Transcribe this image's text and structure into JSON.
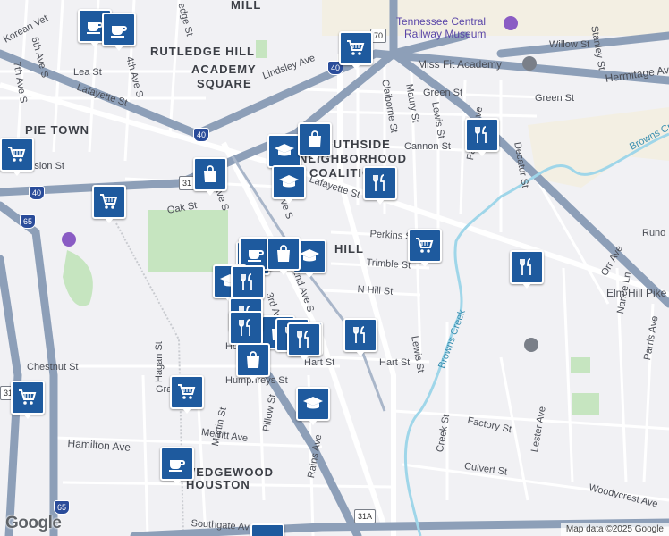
{
  "map": {
    "neighborhoods": [
      {
        "key": "rutledge_hill",
        "text": "RUTLEDGE HILL"
      },
      {
        "key": "academy_square_1",
        "text": "ACADEMY"
      },
      {
        "key": "academy_square_2",
        "text": "SQUARE"
      },
      {
        "key": "pie_town",
        "text": "PIE TOWN"
      },
      {
        "key": "southside_1",
        "text": "SOUTHSIDE"
      },
      {
        "key": "southside_2",
        "text": "NEIGHBORHOOD"
      },
      {
        "key": "southside_3",
        "text": "COALITION"
      },
      {
        "key": "hill",
        "text": "HILL"
      },
      {
        "key": "wedgewood_1",
        "text": "WEDGEWOOD"
      },
      {
        "key": "wedgewood_2",
        "text": "HOUSTON"
      },
      {
        "key": "mill",
        "text": "MILL"
      }
    ],
    "pois": [
      {
        "key": "museum_1",
        "text": "Tennessee Central"
      },
      {
        "key": "museum_2",
        "text": "Railway Museum"
      },
      {
        "key": "missfit",
        "text": "Miss Fit Academy"
      }
    ],
    "streets": [
      {
        "key": "korean_vet",
        "text": "Korean Vet"
      },
      {
        "key": "6th_ave",
        "text": "6th Ave S"
      },
      {
        "key": "4th_ave",
        "text": "4th Ave S"
      },
      {
        "key": "7th_ave",
        "text": "7th Ave S"
      },
      {
        "key": "lea_st",
        "text": "Lea St"
      },
      {
        "key": "lafayette_w",
        "text": "Lafayette St"
      },
      {
        "key": "lafayette_e",
        "text": "Lafayette St"
      },
      {
        "key": "lindsley",
        "text": "Lindsley Ave"
      },
      {
        "key": "claiborne",
        "text": "Claiborne St"
      },
      {
        "key": "maury",
        "text": "Maury St"
      },
      {
        "key": "lewis_n",
        "text": "Lewis St"
      },
      {
        "key": "lewis_s",
        "text": "Lewis St"
      },
      {
        "key": "green_w",
        "text": "Green St"
      },
      {
        "key": "green_e",
        "text": "Green St"
      },
      {
        "key": "fairfield",
        "text": "Fairfield Ave"
      },
      {
        "key": "cannon",
        "text": "Cannon St"
      },
      {
        "key": "decatur",
        "text": "Decatur St"
      },
      {
        "key": "willow",
        "text": "Willow St"
      },
      {
        "key": "stanley",
        "text": "Stanley St"
      },
      {
        "key": "hermitage",
        "text": "Hermitage Ave"
      },
      {
        "key": "browns_creek_n",
        "text": "Browns Creek"
      },
      {
        "key": "browns_creek_s",
        "text": "Browns Creek"
      },
      {
        "key": "division",
        "text": "Division St"
      },
      {
        "key": "oak",
        "text": "Oak St"
      },
      {
        "key": "perkins",
        "text": "Perkins St"
      },
      {
        "key": "trimble",
        "text": "Trimble St"
      },
      {
        "key": "n_hill",
        "text": "N Hill St"
      },
      {
        "key": "runo",
        "text": "Runo"
      },
      {
        "key": "orr",
        "text": "Orr Ave"
      },
      {
        "key": "elm_hill",
        "text": "Elm Hill Pike"
      },
      {
        "key": "nance",
        "text": "Nance Ln"
      },
      {
        "key": "parris",
        "text": "Parris Ave"
      },
      {
        "key": "hart_w",
        "text": "Hart St"
      },
      {
        "key": "hart_e",
        "text": "Hart St"
      },
      {
        "key": "chestnut",
        "text": "Chestnut St"
      },
      {
        "key": "hagan",
        "text": "Hagan St"
      },
      {
        "key": "gra",
        "text": "Gra"
      },
      {
        "key": "martin",
        "text": "Martin St"
      },
      {
        "key": "pillow",
        "text": "Pillow St"
      },
      {
        "key": "humphreys",
        "text": "Humphreys St"
      },
      {
        "key": "merritt",
        "text": "Merritt Ave"
      },
      {
        "key": "hamilton",
        "text": "Hamilton Ave"
      },
      {
        "key": "rains",
        "text": "Rains Ave"
      },
      {
        "key": "creek_st",
        "text": "Creek St"
      },
      {
        "key": "factory",
        "text": "Factory St"
      },
      {
        "key": "lester",
        "text": "Lester Ave"
      },
      {
        "key": "culvert",
        "text": "Culvert St"
      },
      {
        "key": "woodycrest",
        "text": "Woodycrest Ave"
      },
      {
        "key": "southgate",
        "text": "Southgate Ave"
      },
      {
        "key": "3rd_ave",
        "text": "3rd Ave S"
      },
      {
        "key": "2nd_ave",
        "text": "2nd Ave S"
      },
      {
        "key": "ave_s_1",
        "text": "Ave S"
      },
      {
        "key": "ave_s_2",
        "text": "ve S"
      },
      {
        "key": "ho",
        "text": "Ho"
      },
      {
        "key": "edge_st",
        "text": "edge St"
      }
    ],
    "shields": [
      {
        "key": "i40_a",
        "text": "40"
      },
      {
        "key": "i40_b",
        "text": "40"
      },
      {
        "key": "i40_c",
        "text": "40"
      },
      {
        "key": "i65_a",
        "text": "65"
      },
      {
        "key": "i65_b",
        "text": "65"
      },
      {
        "key": "i65_c",
        "text": "65"
      },
      {
        "key": "us31_a",
        "text": "31"
      },
      {
        "key": "us31_b",
        "text": "31"
      },
      {
        "key": "us31a",
        "text": "31A"
      },
      {
        "key": "us70",
        "text": "70"
      }
    ],
    "markers": [
      {
        "id": "m1",
        "type": "coffee"
      },
      {
        "id": "m2",
        "type": "coffee"
      },
      {
        "id": "m3",
        "type": "grocery"
      },
      {
        "id": "m4",
        "type": "grocery"
      },
      {
        "id": "m5",
        "type": "grocery"
      },
      {
        "id": "m6",
        "type": "restaurant"
      },
      {
        "id": "m7",
        "type": "shopping"
      },
      {
        "id": "m8",
        "type": "school"
      },
      {
        "id": "m9",
        "type": "school"
      },
      {
        "id": "m10",
        "type": "shopping"
      },
      {
        "id": "m11",
        "type": "grocery"
      },
      {
        "id": "m12",
        "type": "school"
      },
      {
        "id": "m13",
        "type": "grocery"
      },
      {
        "id": "m14",
        "type": "restaurant"
      },
      {
        "id": "m15",
        "type": "coffee"
      },
      {
        "id": "m16",
        "type": "shopping"
      },
      {
        "id": "m17",
        "type": "restaurant"
      },
      {
        "id": "m18",
        "type": "school"
      },
      {
        "id": "m19",
        "type": "restaurant"
      },
      {
        "id": "m20",
        "type": "shopping"
      },
      {
        "id": "m21",
        "type": "restaurant"
      },
      {
        "id": "m22",
        "type": "coffee"
      },
      {
        "id": "m23",
        "type": "restaurant"
      },
      {
        "id": "m24",
        "type": "restaurant"
      },
      {
        "id": "m25",
        "type": "restaurant"
      },
      {
        "id": "m26",
        "type": "shopping"
      },
      {
        "id": "m27",
        "type": "grocery"
      },
      {
        "id": "m28",
        "type": "school"
      },
      {
        "id": "m29",
        "type": "grocery"
      },
      {
        "id": "m30",
        "type": "coffee"
      },
      {
        "id": "m31",
        "type": "restaurant"
      },
      {
        "id": "m32",
        "type": "coffee"
      }
    ],
    "branding": {
      "logo": "Google",
      "attribution": "Map data ©2025 Google"
    },
    "colors": {
      "water": "#9fd6e9",
      "park": "#c6e5c0",
      "highway": "#8d9fb8",
      "marker": "#1e5a9e"
    }
  }
}
